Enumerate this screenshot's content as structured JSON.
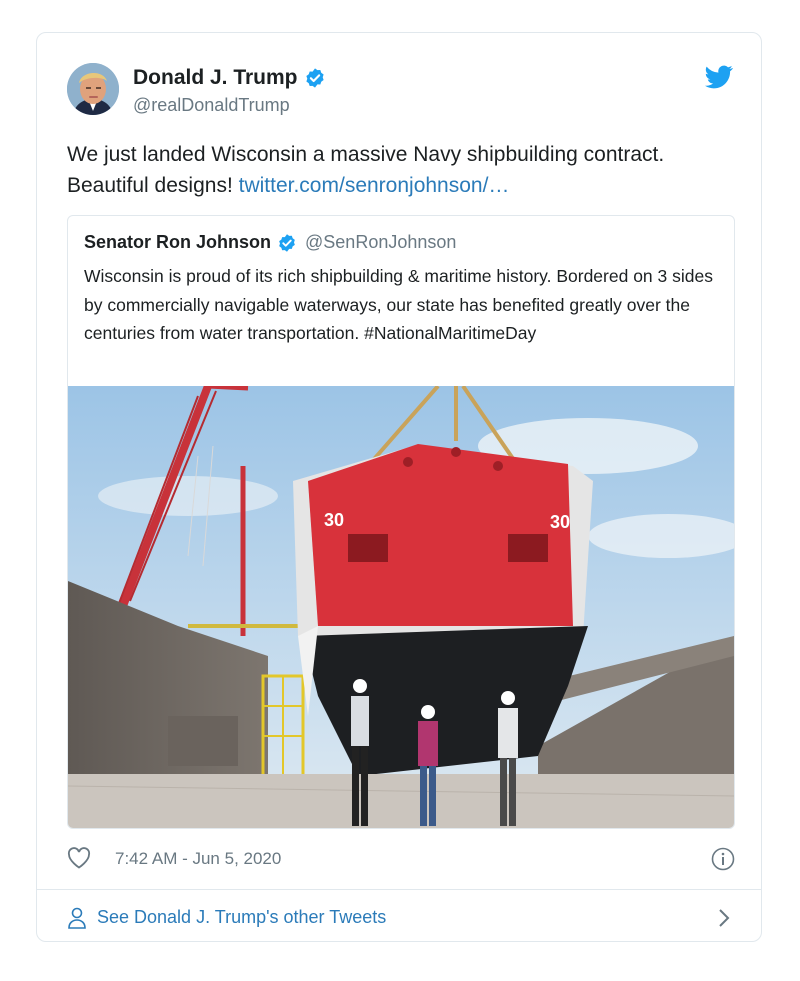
{
  "tweet": {
    "author_name": "Donald J. Trump",
    "author_handle": "@realDonaldTrump",
    "text": "We just landed Wisconsin a massive Navy shipbuilding contract. Beautiful designs!",
    "link": "twitter.com/senronjohnson/…",
    "timestamp": "7:42 AM - Jun 5, 2020"
  },
  "quote": {
    "author_name": "Senator Ron Johnson",
    "author_handle": "@SenRonJohnson",
    "text": "Wisconsin is proud of its rich shipbuilding & maritime history. Bordered on 3 sides by commercially navigable waterways, our state has benefited greatly over the centuries from water transportation. #NationalMaritimeDay",
    "photo": {
      "hull_number": "30"
    }
  },
  "footer": {
    "see_more": "See Donald J. Trump's other Tweets"
  },
  "icons": {
    "verified": "verified-badge-icon",
    "twitter": "twitter-bird-icon",
    "like": "heart-icon",
    "info": "info-icon",
    "person": "person-icon",
    "chevron": "chevron-right-icon"
  },
  "colors": {
    "twitter_blue": "#1da1f2",
    "link_blue": "#2b7bb9",
    "text_primary": "#1c2022",
    "text_secondary": "#697882",
    "border": "#e1e8ed"
  }
}
